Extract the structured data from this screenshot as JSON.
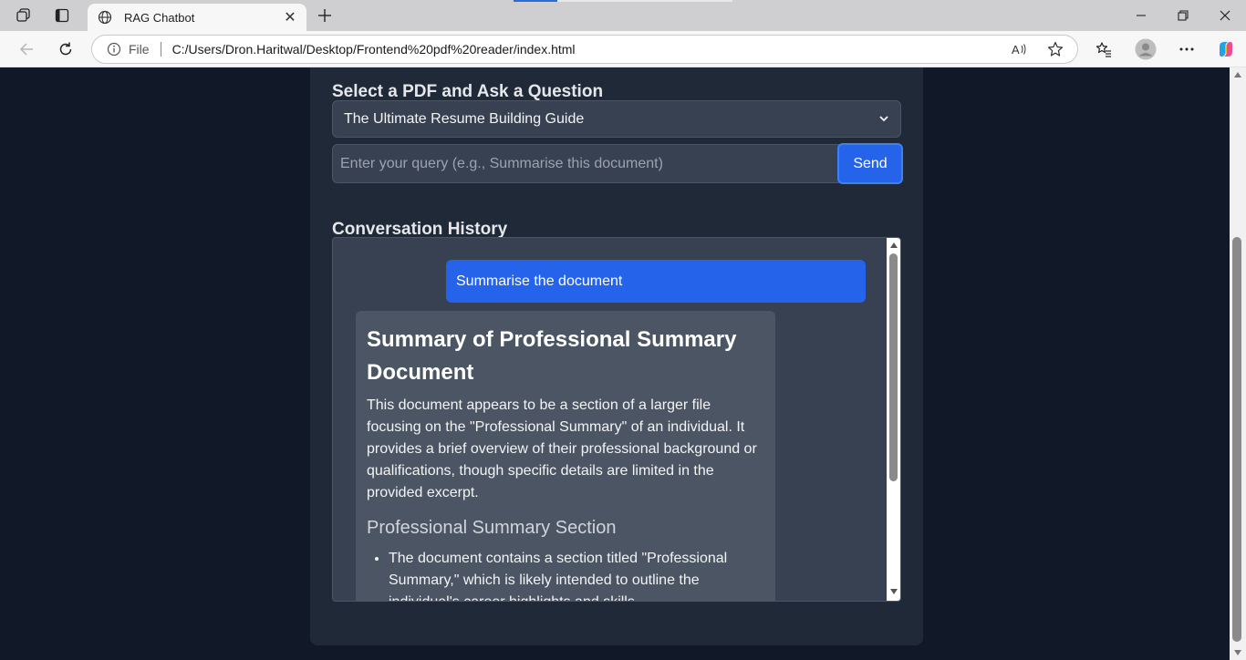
{
  "browser": {
    "tab_title": "RAG Chatbot",
    "tab_close": "✕",
    "address_prefix": "File",
    "url": "C:/Users/Dron.Haritwal/Desktop/Frontend%20pdf%20reader/index.html"
  },
  "page": {
    "select_heading": "Select a PDF and Ask a Question",
    "selected_pdf": "The Ultimate Resume Building Guide",
    "query_placeholder": "Enter your query (e.g., Summarise this document)",
    "send_label": "Send",
    "conversation_heading": "Conversation History"
  },
  "conversation": {
    "user_message": "Summarise the document",
    "bot_title": "Summary of Professional Summary Document",
    "bot_paragraph": "This document appears to be a section of a larger file focusing on the \"Professional Summary\" of an individual. It provides a brief overview of their professional background or qualifications, though specific details are limited in the provided excerpt.",
    "bot_subheading": "Professional Summary Section",
    "bot_bullets": [
      "The document contains a section titled \"Professional Summary,\" which is likely intended to outline the individual's career highlights and skills."
    ]
  },
  "colors": {
    "page_bg": "#111827",
    "card_bg": "#1f2937",
    "accent": "#2563eb"
  }
}
